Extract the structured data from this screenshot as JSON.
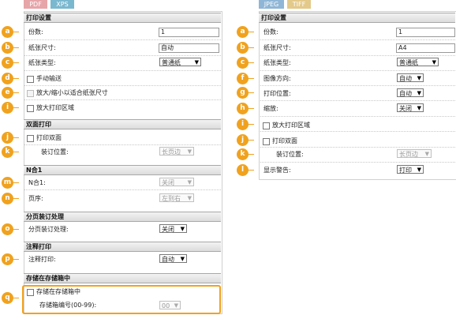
{
  "left_tabs": [
    "PDF",
    "XPS"
  ],
  "right_tabs": [
    "JPEG",
    "TIFF"
  ],
  "colors": {
    "accent": "#f0a21e",
    "tag_pink": "#e6a5a9",
    "tag_blue": "#7ab8cf",
    "tag_jpeg": "#8fb6d6",
    "tag_tiff": "#e3c98a"
  },
  "left": {
    "print_settings": {
      "title": "打印设置",
      "copies": {
        "badge": "a",
        "label": "份数:",
        "value": "1"
      },
      "paper_size": {
        "badge": "b",
        "label": "纸张尺寸:",
        "value": "自动"
      },
      "paper_type": {
        "badge": "c",
        "label": "纸张类型:",
        "value": "普通纸"
      },
      "manual_feed": {
        "badge": "d",
        "label": "手动输送"
      },
      "fit_paper": {
        "badge": "e",
        "label": "放大/缩小以适合纸张尺寸"
      },
      "enlarge_area": {
        "badge": "i",
        "label": "放大打印区域"
      }
    },
    "duplex": {
      "title": "双面打印",
      "duplex_cb": {
        "badge": "j",
        "label": "打印双面"
      },
      "binding": {
        "badge": "k",
        "label": "装订位置:",
        "value": "长页边"
      }
    },
    "nup": {
      "title": "N合1",
      "nup": {
        "badge": "m",
        "label": "N合1:",
        "value": "关闭"
      },
      "order": {
        "badge": "n",
        "label": "页序:",
        "value": "左到右"
      }
    },
    "collate": {
      "title": "分页装订处理",
      "collate": {
        "badge": "o",
        "label": "分页装订处理:",
        "value": "关闭"
      }
    },
    "annotation": {
      "title": "注释打印",
      "annot": {
        "badge": "p",
        "label": "注释打印:",
        "value": "自动"
      }
    },
    "mailbox": {
      "title": "存储在存储箱中",
      "badge": "q",
      "store_cb": {
        "label": "存储在存储箱中"
      },
      "box_no": {
        "label": "存储箱编号(00-99):",
        "value": "00"
      }
    }
  },
  "right": {
    "title": "打印设置",
    "copies": {
      "badge": "a",
      "label": "份数:",
      "value": "1"
    },
    "paper_size": {
      "badge": "b",
      "label": "纸张尺寸:",
      "value": "A4"
    },
    "paper_type": {
      "badge": "c",
      "label": "纸张类型:",
      "value": "普通纸"
    },
    "orientation": {
      "badge": "f",
      "label": "图像方向:",
      "value": "自动"
    },
    "position": {
      "badge": "g",
      "label": "打印位置:",
      "value": "自动"
    },
    "zoom": {
      "badge": "h",
      "label": "缩放:",
      "value": "关闭"
    },
    "enlarge_area": {
      "badge": "i",
      "label": "放大打印区域"
    },
    "duplex_cb": {
      "badge": "j",
      "label": "打印双面"
    },
    "binding": {
      "badge": "k",
      "label": "装订位置:",
      "value": "长页边"
    },
    "warning": {
      "badge": "l",
      "label": "显示警告:",
      "value": "打印"
    }
  }
}
